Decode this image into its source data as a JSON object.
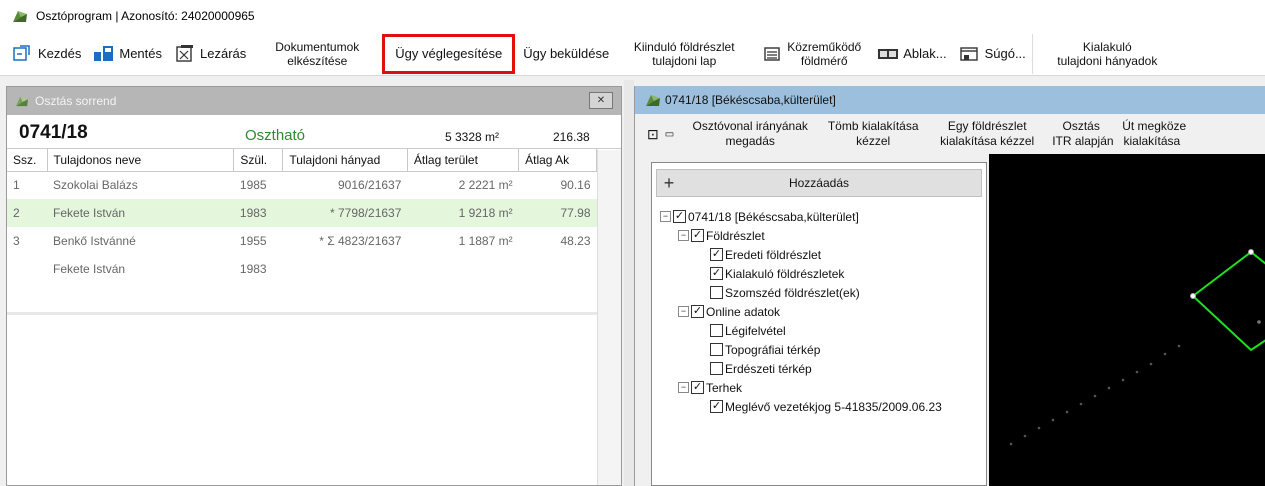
{
  "window": {
    "title": "Osztóprogram | Azonosító: 24020000965"
  },
  "toolbar": {
    "start": "Kezdés",
    "save": "Mentés",
    "close": "Lezárás",
    "docs_line1": "Dokumentumok",
    "docs_line2": "elkészítése",
    "finalize": "Ügy véglegesítése",
    "submit": "Ügy beküldése",
    "orig_line1": "Kiinduló földrészlet",
    "orig_line2": "tulajdoni lap",
    "surveyor_line1": "Közreműködő",
    "surveyor_line2": "földmérő",
    "window": "Ablak...",
    "help": "Súgó...",
    "resulting_line1": "Kialakuló",
    "resulting_line2": "tulajdoni hányadok"
  },
  "left_panel": {
    "title": "Osztás sorrend",
    "parcel": "0741/18",
    "status": "Osztható",
    "area": "5 3328 m²",
    "ak": "216.38",
    "columns": [
      "Ssz.",
      "Tulajdonos neve",
      "Szül.",
      "Tulajdoni hányad",
      "Átlag terület",
      "Átlag Ak"
    ],
    "rows": [
      [
        "1",
        "Szokolai Balázs",
        "1985",
        "9016/21637",
        "2 2221 m²",
        "90.16"
      ],
      [
        "2",
        "Fekete István",
        "1983",
        "* 7798/21637",
        "1 9218 m²",
        "77.98"
      ],
      [
        "3",
        "Benkő Istvánné",
        "1955",
        "* Σ 4823/21637",
        "1 1887 m²",
        "48.23"
      ],
      [
        "",
        "Fekete István",
        "1983",
        "",
        "",
        ""
      ]
    ]
  },
  "right_panel": {
    "title": "0741/18 [Békéscsaba,külterület]",
    "tools": {
      "t1_line1": "Osztóvonal irányának",
      "t1_line2": "megadás",
      "t2_line1": "Tömb kialakítása",
      "t2_line2": "kézzel",
      "t3_line1": "Egy földrészlet",
      "t3_line2": "kialakítása kézzel",
      "t4_line1": "Osztás",
      "t4_line2": "ITR alapján",
      "t5_line1": "Út megközel",
      "t5_line2": "kialakítása"
    },
    "add_label": "Hozzáadás",
    "tree": {
      "root": "0741/18 [Békéscsaba,külterület]",
      "foldreszlet": "Földrészlet",
      "eredeti": "Eredeti földrészlet",
      "kialakulo": "Kialakuló földrészletek",
      "szomszed": "Szomszéd földrészlet(ek)",
      "online": "Online adatok",
      "legi": "Légifelvétel",
      "topo": "Topográfiai térkép",
      "erdo": "Erdészeti térkép",
      "terhek": "Terhek",
      "vezetek": "Meglévő vezetékjog 5-41835/2009.06.23"
    }
  },
  "colors": {
    "highlight": "#e01010",
    "selected_row": "#e4f6dc",
    "ok_status": "#2e8b2e",
    "map_line": "#1fe01f"
  }
}
